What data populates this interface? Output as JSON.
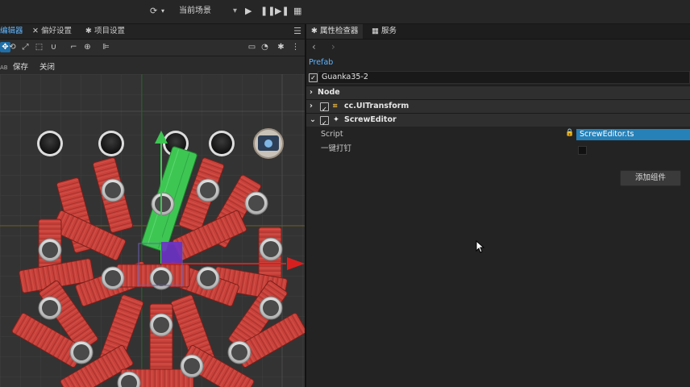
{
  "top_toolbar": {
    "scene_label": "当前场景"
  },
  "editor_tabs": [
    {
      "label": "编辑器",
      "icon": "",
      "active": true
    },
    {
      "label": "偏好设置",
      "icon": "tools-icon",
      "active": false
    },
    {
      "label": "项目设置",
      "icon": "gear-icon",
      "active": false
    }
  ],
  "scene_actions": {
    "prefab_tag": "AB",
    "save_label": "保存",
    "close_label": "关闭"
  },
  "inspector": {
    "tabs": [
      {
        "label": "属性检查器",
        "icon": "gear-icon",
        "active": true
      },
      {
        "label": "服务",
        "icon": "grid-icon",
        "active": false
      }
    ],
    "prefab_label": "Prefab",
    "node_name": "Guanka35-2",
    "node_section_label": "Node",
    "components": [
      {
        "label": "cc.UITransform",
        "expanded": false,
        "enabled": true
      },
      {
        "label": "ScrewEditor",
        "expanded": true,
        "enabled": true
      }
    ],
    "script_label": "Script",
    "script_value": "ScrewEditor.ts",
    "one_click_label": "一键打钉",
    "add_component_label": "添加组件"
  },
  "colors": {
    "accent_blue": "#2681b8",
    "link_blue": "#5fb6ff",
    "plank_red": "#c8413a",
    "highlight_green": "#3ec653",
    "gizmo_purple": "#6b33c7",
    "gizmo_red": "#d81f1f"
  }
}
